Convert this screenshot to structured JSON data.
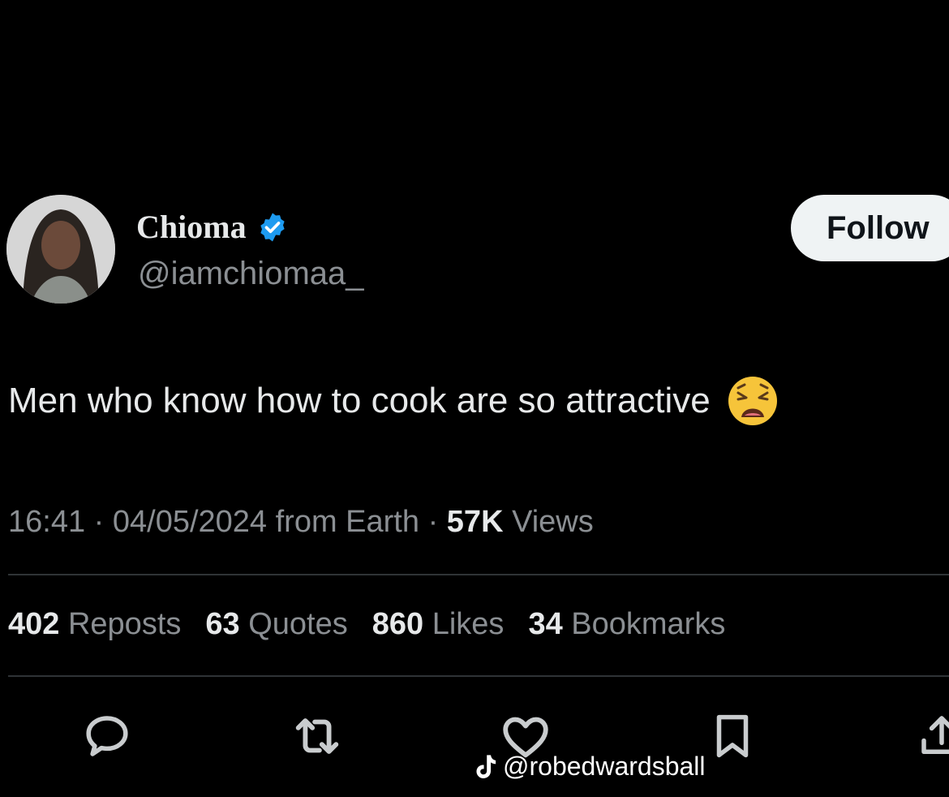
{
  "author": {
    "display_name": "Chioma",
    "handle": "@iamchiomaa_",
    "verified": true,
    "verified_color": "#1d9bf0"
  },
  "follow_button": {
    "label": "Follow"
  },
  "tweet": {
    "text": "Men who know how to cook are so attractive",
    "emoji": "weary-face-emoji"
  },
  "meta": {
    "time": "16:41",
    "separator": " · ",
    "date": "04/05/2024",
    "source": " from Earth",
    "views_count": "57K",
    "views_label": " Views"
  },
  "stats": [
    {
      "count": "402",
      "label": "Reposts"
    },
    {
      "count": "63",
      "label": "Quotes"
    },
    {
      "count": "860",
      "label": "Likes"
    },
    {
      "count": "34",
      "label": "Bookmarks"
    }
  ],
  "actions": [
    "reply-icon",
    "repost-icon",
    "like-icon",
    "bookmark-icon",
    "share-icon"
  ],
  "watermark": {
    "text": "@robedwardsball",
    "icon": "tiktok-icon"
  },
  "colors": {
    "background": "#000000",
    "primary_text": "#e7e9ea",
    "secondary_text": "#8b8f93",
    "divider": "#2f3336",
    "button_bg": "#eff3f4"
  }
}
